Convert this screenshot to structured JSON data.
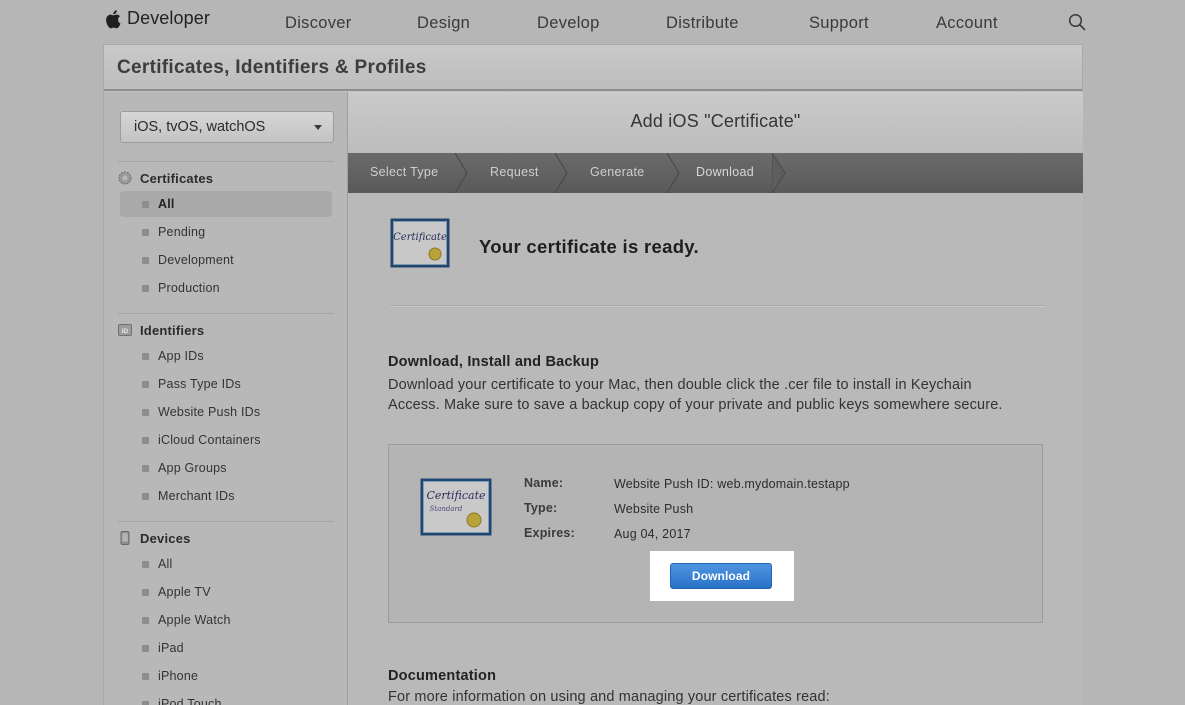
{
  "nav": {
    "brand": "Developer",
    "links": [
      "Discover",
      "Design",
      "Develop",
      "Distribute",
      "Support",
      "Account"
    ]
  },
  "panel": {
    "title": "Certificates, Identifiers & Profiles"
  },
  "sidebar": {
    "platform": "iOS, tvOS, watchOS",
    "sections": [
      {
        "title": "Certificates",
        "icon": "certificate-gear-icon",
        "items": [
          "All",
          "Pending",
          "Development",
          "Production"
        ]
      },
      {
        "title": "Identifiers",
        "icon": "id-badge-icon",
        "items": [
          "App IDs",
          "Pass Type IDs",
          "Website Push IDs",
          "iCloud Containers",
          "App Groups",
          "Merchant IDs"
        ]
      },
      {
        "title": "Devices",
        "icon": "phone-icon",
        "items": [
          "All",
          "Apple TV",
          "Apple Watch",
          "iPad",
          "iPhone",
          "iPod Touch"
        ]
      }
    ],
    "active_item": "Certificates / All"
  },
  "main": {
    "title": "Add iOS \"Certificate\"",
    "steps": [
      "Select Type",
      "Request",
      "Generate",
      "Download"
    ],
    "current_step": "Download",
    "ready_text": "Your certificate is ready.",
    "download_section": {
      "heading": "Download, Install and Backup",
      "line1": "Download your certificate to your Mac, then double click the .cer file to install in Keychain",
      "line2": "Access. Make sure to save a backup copy of your private and public keys somewhere secure."
    },
    "certificate": {
      "name_label": "Name:",
      "name_value": "Website Push ID: web.mydomain.testapp",
      "type_label": "Type:",
      "type_value": "Website Push",
      "expires_label": "Expires:",
      "expires_value": "Aug 04, 2017",
      "download_button": "Download"
    },
    "documentation": {
      "heading": "Documentation",
      "text": "For more information on using and managing your certificates read:"
    }
  },
  "colors": {
    "button": "#2f78cc",
    "steps_bar": "#636363"
  }
}
